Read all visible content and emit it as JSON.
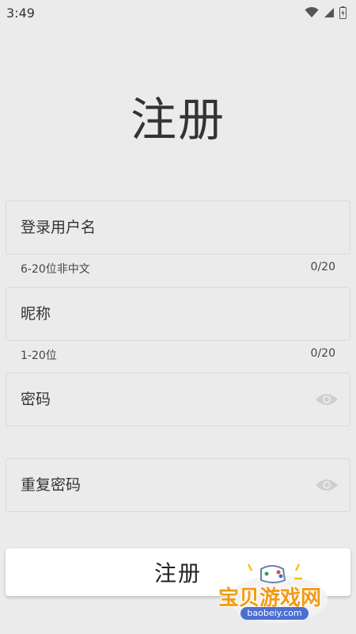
{
  "status_bar": {
    "time": "3:49",
    "icons": [
      "wifi-icon",
      "cellular-signal-icon",
      "battery-icon"
    ]
  },
  "title": "注册",
  "fields": {
    "username": {
      "placeholder": "登录用户名",
      "hint": "6-20位非中文",
      "counter": "0/20"
    },
    "nickname": {
      "placeholder": "昵称",
      "hint": "1-20位",
      "counter": "0/20"
    },
    "password": {
      "placeholder": "密码",
      "icon": "eye-icon"
    },
    "repeat_password": {
      "placeholder": "重复密码",
      "icon": "eye-icon"
    }
  },
  "submit_label": "注册",
  "watermark": {
    "text": "宝贝游戏网",
    "url": "baobeiy.com"
  },
  "colors": {
    "background": "#ebebeb",
    "button": "#ffffff",
    "watermark_orange": "#f29a12",
    "watermark_blue": "#4c6fd0"
  }
}
